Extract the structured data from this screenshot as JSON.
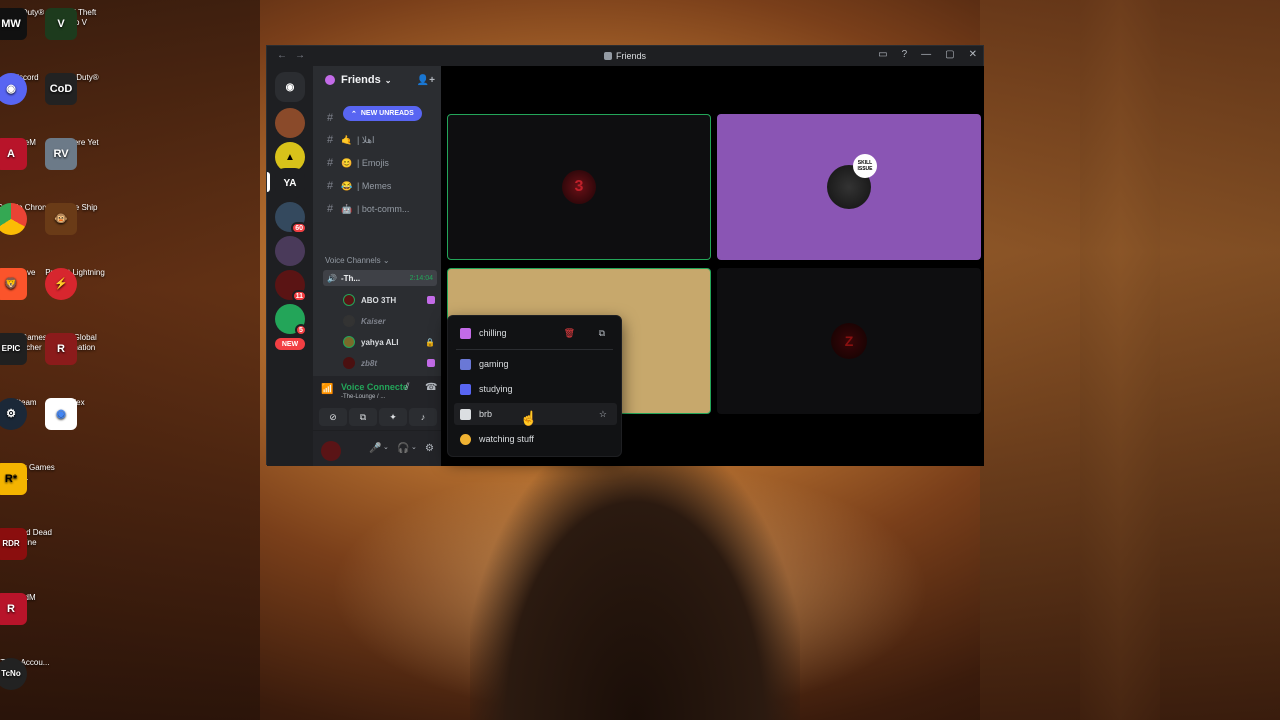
{
  "desktop": {
    "icons": [
      {
        "label": "Call of Duty® ...",
        "tile": "MW",
        "color": "#111111"
      },
      {
        "label": "Grand Theft Auto V",
        "tile": "V",
        "color": "#1d3b1d"
      },
      {
        "label": "Discord",
        "tile": "",
        "color": "#5865f2"
      },
      {
        "label": "Call of Duty®",
        "tile": "CoD",
        "color": "#222222"
      },
      {
        "label": "FiveM",
        "tile": "A",
        "color": "#b8142a"
      },
      {
        "label": "RV There Yet",
        "tile": "RV",
        "color": "#6c7a88"
      },
      {
        "label": "Google Chrome",
        "tile": "",
        "color": "#ffffff"
      },
      {
        "label": "Go Ape Ship",
        "tile": "",
        "color": "#6a3b17"
      },
      {
        "label": "Brave",
        "tile": "",
        "color": "#fb542b"
      },
      {
        "label": "Project Lightning",
        "tile": "",
        "color": "#d7262e"
      },
      {
        "label": "Epic Games Launcher",
        "tile": "EPIC",
        "color": "#202020"
      },
      {
        "label": "RiSK Global Domination",
        "tile": "R",
        "color": "#8b1b1b"
      },
      {
        "label": "Steam",
        "tile": "",
        "color": "#1b2838"
      },
      {
        "label": "index",
        "tile": "",
        "color": "#ffffff"
      },
      {
        "label": "Rockstar Games ...",
        "tile": "R*",
        "color": "#f4b400"
      },
      {
        "label": "Play Red Dead Online",
        "tile": "RDR",
        "color": "#8a0e0e"
      },
      {
        "label": "RedM",
        "tile": "R",
        "color": "#b8142a"
      },
      {
        "label": "TcNo Accou...",
        "tile": "TcNo",
        "color": "#222222"
      }
    ]
  },
  "window": {
    "title": "Friends",
    "controls": [
      "▭",
      "?",
      "—",
      "▢",
      "✕"
    ]
  },
  "servers": {
    "badges": [
      "11",
      "60",
      "5"
    ],
    "new_label": "NEW",
    "ya_label": "YA"
  },
  "channels": {
    "header": "Friends",
    "new_unreads": "NEW UNREADS",
    "text": [
      {
        "emoji": "🤙",
        "name": "| اهلا"
      },
      {
        "emoji": "😊",
        "name": "| Emojis"
      },
      {
        "emoji": "😂",
        "name": "| Memes"
      },
      {
        "emoji": "🤖",
        "name": "| bot-comm..."
      }
    ],
    "voice_category": "Voice Channels",
    "voice_channel": {
      "name": "-Th...",
      "time": "2:14:04"
    },
    "users": [
      {
        "name": "ABO 3TH",
        "color": "#5a1414",
        "dim": false,
        "live": true
      },
      {
        "name": "Kaiser",
        "color": "#333333",
        "dim": true,
        "live": false
      },
      {
        "name": "yahya ALI",
        "color": "#7a6a2a",
        "dim": false,
        "live": false
      },
      {
        "name": "zb8t",
        "color": "#4a1010",
        "dim": true,
        "live": true
      }
    ]
  },
  "voice_panel": {
    "status": "Voice Connecte",
    "sub": "-The-Lounge / ..."
  },
  "video_tiles": {
    "skill_issue": "SKILL ISSUE"
  },
  "activity_menu": {
    "items": [
      {
        "label": "chilling",
        "icon_color": "#c36be8"
      },
      {
        "label": "gaming",
        "icon_color": "#6a78d6"
      },
      {
        "label": "studying",
        "icon_color": "#5865f2"
      },
      {
        "label": "brb",
        "icon_color": "#dbdee1"
      },
      {
        "label": "watching stuff",
        "icon_color": "#f0b232"
      }
    ]
  }
}
